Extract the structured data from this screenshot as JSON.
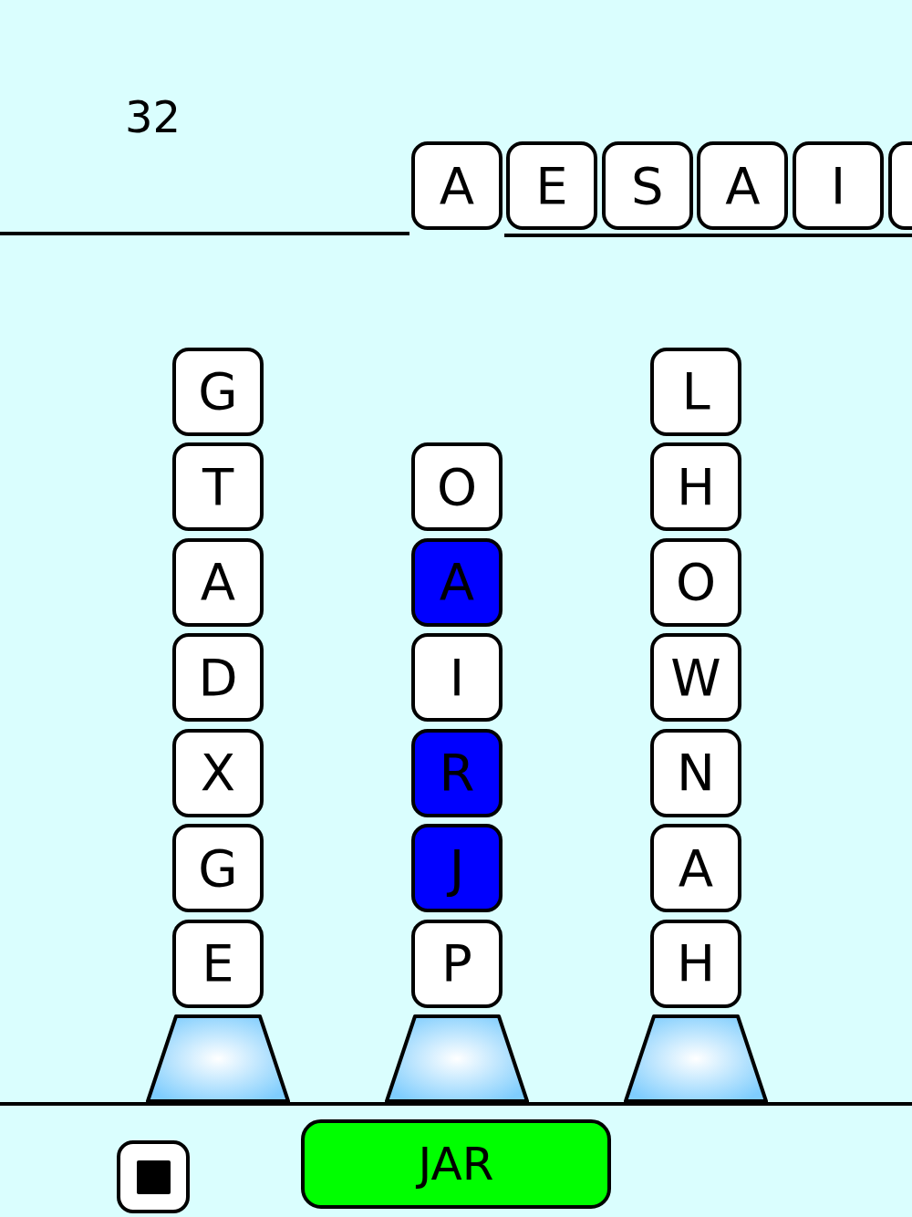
{
  "score": "32",
  "tray": {
    "tiles": [
      "A",
      "E",
      "S",
      "A",
      "I"
    ],
    "cut_off_tile": true
  },
  "columns": [
    {
      "tiles": [
        {
          "letter": "G",
          "selected": false
        },
        {
          "letter": "T",
          "selected": false
        },
        {
          "letter": "A",
          "selected": false
        },
        {
          "letter": "D",
          "selected": false
        },
        {
          "letter": "X",
          "selected": false
        },
        {
          "letter": "G",
          "selected": false
        },
        {
          "letter": "E",
          "selected": false
        }
      ]
    },
    {
      "tiles": [
        {
          "letter": "O",
          "selected": false
        },
        {
          "letter": "A",
          "selected": true
        },
        {
          "letter": "I",
          "selected": false
        },
        {
          "letter": "R",
          "selected": true
        },
        {
          "letter": "J",
          "selected": true
        },
        {
          "letter": "P",
          "selected": false
        }
      ]
    },
    {
      "tiles": [
        {
          "letter": "L",
          "selected": false
        },
        {
          "letter": "H",
          "selected": false
        },
        {
          "letter": "O",
          "selected": false
        },
        {
          "letter": "W",
          "selected": false
        },
        {
          "letter": "N",
          "selected": false
        },
        {
          "letter": "A",
          "selected": false
        },
        {
          "letter": "H",
          "selected": false
        }
      ]
    }
  ],
  "word_button": {
    "label": "JAR"
  }
}
